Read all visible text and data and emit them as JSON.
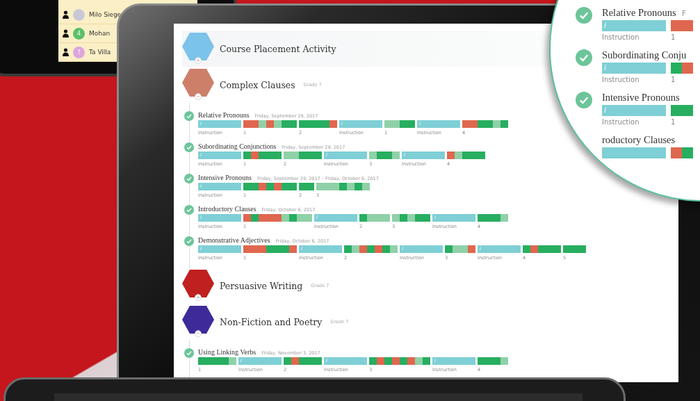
{
  "roster": [
    {
      "name": "Milo Siege",
      "color": "#c9c9d6"
    },
    {
      "name": "Mohan",
      "badge": "4",
      "color": "#5cc06a"
    },
    {
      "name": "Ta Villa",
      "badge": "?",
      "color": "#dca6dc"
    }
  ],
  "units": [
    {
      "title": "Course Placement Activity",
      "color": "#7cc3ea",
      "expanded": false
    },
    {
      "title": "Complex Clauses",
      "grade": "Grade 7",
      "color": "#cd7f6a",
      "expanded": true,
      "lessons": [
        {
          "title": "Relative Pronouns",
          "date": "Friday, September 29, 2017",
          "blocks": [
            {
              "kind": "instruction",
              "mark": "i",
              "label": "Instruction"
            },
            {
              "kind": "practice",
              "label": "1",
              "cells": [
                {
                  "color": "#e0674f"
                },
                {
                  "color": "#e0674f"
                },
                {
                  "color": "#8fd1a8"
                },
                {
                  "color": "#e0674f"
                },
                {
                  "color": "#8fd1a8"
                },
                {
                  "color": "#27ae60"
                },
                {
                  "color": "#27ae60"
                }
              ]
            },
            {
              "kind": "practice",
              "label": "2",
              "cells": [
                {
                  "color": "#27ae60"
                },
                {
                  "color": "#27ae60"
                },
                {
                  "color": "#27ae60"
                },
                {
                  "color": "#27ae60"
                },
                {
                  "color": "#e0674f"
                }
              ]
            },
            {
              "kind": "instruction",
              "mark": "i",
              "label": "Instruction"
            },
            {
              "kind": "practice",
              "label": "1",
              "cells": [
                {
                  "color": "#8fd1a8"
                },
                {
                  "color": "#8fd1a8"
                },
                {
                  "color": "#27ae60"
                },
                {
                  "color": "#27ae60"
                }
              ]
            },
            {
              "kind": "instruction",
              "mark": "i",
              "label": "Instruction"
            },
            {
              "kind": "practice",
              "label": "4",
              "cells": [
                {
                  "color": "#e0674f"
                },
                {
                  "color": "#e0674f"
                },
                {
                  "color": "#27ae60"
                },
                {
                  "color": "#27ae60"
                },
                {
                  "color": "#8fd1a8"
                },
                {
                  "color": "#27ae60"
                }
              ]
            }
          ]
        },
        {
          "title": "Subordinating Conjunctions",
          "date": "Friday, September 29, 2017",
          "blocks": [
            {
              "kind": "instruction",
              "mark": "i",
              "label": "Instruction"
            },
            {
              "kind": "practice",
              "label": "1",
              "cells": [
                {
                  "color": "#27ae60"
                },
                {
                  "color": "#e0674f"
                },
                {
                  "color": "#27ae60"
                },
                {
                  "color": "#27ae60"
                },
                {
                  "color": "#27ae60"
                }
              ]
            },
            {
              "kind": "practice",
              "label": "2",
              "cells": [
                {
                  "color": "#8fd1a8"
                },
                {
                  "color": "#8fd1a8"
                },
                {
                  "color": "#27ae60"
                },
                {
                  "color": "#27ae60"
                },
                {
                  "color": "#27ae60"
                }
              ]
            },
            {
              "kind": "instruction",
              "mark": "i",
              "label": "Instruction"
            },
            {
              "kind": "practice",
              "label": "3",
              "cells": [
                {
                  "color": "#8fd1a8"
                },
                {
                  "color": "#27ae60"
                },
                {
                  "color": "#27ae60"
                },
                {
                  "color": "#8fd1a8"
                }
              ]
            },
            {
              "kind": "instruction",
              "mark": "i",
              "label": "Instruction"
            },
            {
              "kind": "practice",
              "label": "4",
              "cells": [
                {
                  "color": "#e0674f"
                },
                {
                  "color": "#8fd1a8"
                },
                {
                  "color": "#27ae60"
                },
                {
                  "color": "#27ae60"
                },
                {
                  "color": "#27ae60"
                }
              ]
            }
          ]
        },
        {
          "title": "Intensive Pronouns",
          "date": "Friday, September 29, 2017 – Friday, October 6, 2017",
          "blocks": [
            {
              "kind": "instruction",
              "mark": "i",
              "label": "Instruction"
            },
            {
              "kind": "practice",
              "label": "1",
              "cells": [
                {
                  "color": "#27ae60"
                },
                {
                  "color": "#27ae60"
                },
                {
                  "color": "#e0674f"
                },
                {
                  "color": "#27ae60"
                },
                {
                  "color": "#e0674f"
                },
                {
                  "color": "#27ae60"
                },
                {
                  "color": "#27ae60"
                }
              ]
            },
            {
              "kind": "practice",
              "label": "2",
              "cells": [
                {
                  "color": "#27ae60"
                },
                {
                  "color": "#27ae60"
                }
              ]
            },
            {
              "kind": "practice",
              "label": "3",
              "cells": [
                {
                  "color": "#8fd1a8"
                },
                {
                  "color": "#8fd1a8"
                },
                {
                  "color": "#8fd1a8"
                },
                {
                  "color": "#27ae60"
                },
                {
                  "color": "#8fd1a8"
                },
                {
                  "color": "#27ae60"
                },
                {
                  "color": "#8fd1a8"
                }
              ]
            }
          ]
        },
        {
          "title": "Introductory Clauses",
          "date": "Friday, October 6, 2017",
          "blocks": [
            {
              "kind": "instruction",
              "mark": "i",
              "label": "Instruction"
            },
            {
              "kind": "practice",
              "label": "1",
              "cells": [
                {
                  "color": "#e0674f"
                },
                {
                  "color": "#27ae60"
                },
                {
                  "color": "#e0674f"
                },
                {
                  "color": "#e0674f"
                },
                {
                  "color": "#e0674f"
                },
                {
                  "color": "#8fd1a8"
                },
                {
                  "color": "#27ae60"
                },
                {
                  "color": "#8fd1a8"
                },
                {
                  "color": "#8fd1a8"
                }
              ]
            },
            {
              "kind": "instruction",
              "mark": "i",
              "label": "Instruction"
            },
            {
              "kind": "practice",
              "label": "2",
              "cells": [
                {
                  "color": "#27ae60"
                },
                {
                  "color": "#8fd1a8"
                },
                {
                  "color": "#8fd1a8"
                },
                {
                  "color": "#8fd1a8"
                }
              ]
            },
            {
              "kind": "practice",
              "label": "3",
              "cells": [
                {
                  "color": "#8fd1a8"
                },
                {
                  "color": "#27ae60"
                },
                {
                  "color": "#8fd1a8"
                },
                {
                  "color": "#27ae60"
                },
                {
                  "color": "#27ae60"
                }
              ]
            },
            {
              "kind": "instruction",
              "mark": "i",
              "label": "Instruction"
            },
            {
              "kind": "practice",
              "label": "4",
              "cells": [
                {
                  "color": "#27ae60"
                },
                {
                  "color": "#27ae60"
                },
                {
                  "color": "#27ae60"
                },
                {
                  "color": "#8fd1a8"
                }
              ]
            }
          ]
        },
        {
          "title": "Demonstrative Adjectives",
          "date": "Friday, October 6, 2017",
          "blocks": [
            {
              "kind": "instruction",
              "mark": "i",
              "label": "Instruction"
            },
            {
              "kind": "practice",
              "label": "1",
              "cells": [
                {
                  "color": "#e0674f"
                },
                {
                  "color": "#e0674f"
                },
                {
                  "color": "#e0674f"
                },
                {
                  "color": "#27ae60"
                },
                {
                  "color": "#27ae60"
                },
                {
                  "color": "#27ae60"
                },
                {
                  "color": "#e0674f"
                }
              ]
            },
            {
              "kind": "instruction",
              "mark": "i",
              "label": "Instruction"
            },
            {
              "kind": "practice",
              "label": "2",
              "cells": [
                {
                  "color": "#27ae60"
                },
                {
                  "color": "#8fd1a8"
                },
                {
                  "color": "#e0674f"
                },
                {
                  "color": "#27ae60"
                },
                {
                  "color": "#e0674f"
                },
                {
                  "color": "#27ae60"
                },
                {
                  "color": "#8fd1a8"
                }
              ]
            },
            {
              "kind": "instruction",
              "mark": "i",
              "label": "Instruction"
            },
            {
              "kind": "practice",
              "label": "3",
              "cells": [
                {
                  "color": "#27ae60"
                },
                {
                  "color": "#8fd1a8"
                },
                {
                  "color": "#8fd1a8"
                },
                {
                  "color": "#e0674f"
                }
              ]
            },
            {
              "kind": "instruction",
              "mark": "i",
              "label": "Instruction"
            },
            {
              "kind": "practice",
              "label": "4",
              "cells": [
                {
                  "color": "#27ae60"
                },
                {
                  "color": "#e0674f"
                },
                {
                  "color": "#27ae60"
                },
                {
                  "color": "#27ae60"
                },
                {
                  "color": "#27ae60"
                }
              ]
            },
            {
              "kind": "practice",
              "label": "5",
              "cells": [
                {
                  "color": "#27ae60"
                },
                {
                  "color": "#27ae60"
                },
                {
                  "color": "#27ae60"
                }
              ]
            }
          ]
        }
      ]
    },
    {
      "title": "Persuasive Writing",
      "grade": "Grade 7",
      "color": "#c0201f",
      "expanded": false
    },
    {
      "title": "Non-Fiction and Poetry",
      "grade": "Grade 7",
      "color": "#3f2a9a",
      "expanded": true,
      "lessons": [
        {
          "title": "Using Linking Verbs",
          "date": "Friday, November 3, 2017",
          "blocks": [
            {
              "kind": "practice",
              "label": "1",
              "cells": [
                {
                  "color": "#27ae60"
                },
                {
                  "color": "#27ae60"
                },
                {
                  "color": "#27ae60"
                },
                {
                  "color": "#27ae60"
                },
                {
                  "color": "#8fd1a8"
                }
              ]
            },
            {
              "kind": "instruction",
              "mark": "i",
              "label": "Instruction"
            },
            {
              "kind": "practice",
              "label": "2",
              "cells": [
                {
                  "color": "#27ae60"
                },
                {
                  "color": "#e0674f"
                },
                {
                  "color": "#27ae60"
                },
                {
                  "color": "#27ae60"
                },
                {
                  "color": "#27ae60"
                }
              ]
            },
            {
              "kind": "instruction",
              "mark": "i",
              "label": "Instruction"
            },
            {
              "kind": "practice",
              "label": "3",
              "cells": [
                {
                  "color": "#27ae60"
                },
                {
                  "color": "#e0674f"
                },
                {
                  "color": "#27ae60"
                },
                {
                  "color": "#e0674f"
                },
                {
                  "color": "#27ae60"
                },
                {
                  "color": "#e0674f"
                },
                {
                  "color": "#8fd1a8"
                },
                {
                  "color": "#27ae60"
                }
              ]
            },
            {
              "kind": "instruction",
              "mark": "i",
              "label": "Instruction"
            },
            {
              "kind": "practice",
              "label": "4",
              "cells": [
                {
                  "color": "#27ae60"
                },
                {
                  "color": "#27ae60"
                },
                {
                  "color": "#27ae60"
                },
                {
                  "color": "#8fd1a8"
                }
              ]
            }
          ]
        }
      ]
    }
  ],
  "magnifier": {
    "lessons": [
      {
        "title": "Relative Pronouns",
        "date": "F",
        "blocks": [
          {
            "kind": "instruction",
            "mark": "i",
            "label": "Instruction"
          },
          {
            "kind": "practice",
            "label": "1",
            "cells": [
              {
                "color": "#e0674f"
              },
              {
                "color": "#e0674f"
              }
            ]
          }
        ]
      },
      {
        "title": "Subordinating Conju",
        "blocks": [
          {
            "kind": "instruction",
            "mark": "i",
            "label": "Instruction"
          },
          {
            "kind": "practice",
            "label": "1",
            "cells": [
              {
                "color": "#27ae60"
              },
              {
                "color": "#e0674f"
              }
            ]
          }
        ]
      },
      {
        "title": "Intensive Pronouns",
        "blocks": [
          {
            "kind": "instruction",
            "mark": "i",
            "label": "Instruction"
          },
          {
            "kind": "practice",
            "label": "1",
            "cells": [
              {
                "color": "#27ae60"
              },
              {
                "color": "#27ae60"
              }
            ]
          }
        ]
      },
      {
        "title": "roductory Clauses",
        "blocks": [
          {
            "kind": "instruction"
          },
          {
            "kind": "practice",
            "cells": [
              {
                "color": "#e0674f"
              },
              {
                "color": "#27ae60"
              }
            ]
          }
        ]
      }
    ]
  }
}
